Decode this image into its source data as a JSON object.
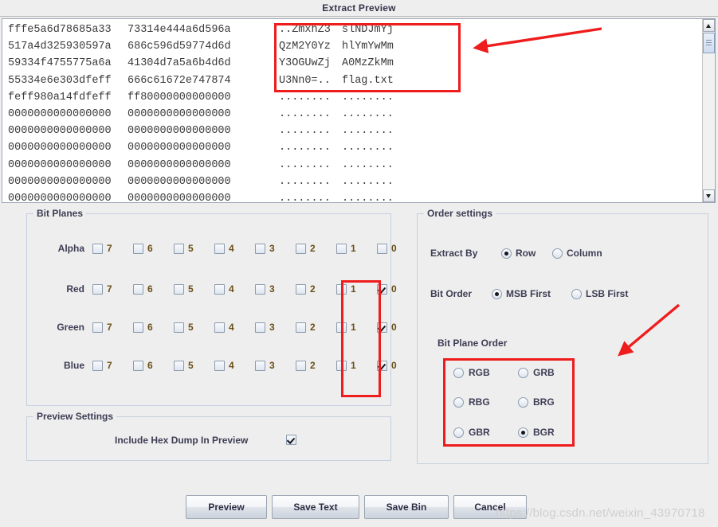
{
  "window": {
    "title": "Extract Preview"
  },
  "hex_dump": {
    "lines": [
      {
        "hex1": "fffe5a6d78685a33",
        "hex2": "73314e444a6d596a",
        "ascii1": "..ZmxhZ3",
        "ascii2": "slNDJmYj"
      },
      {
        "hex1": "517a4d325930597a",
        "hex2": "686c596d59774d6d",
        "ascii1": "QzM2Y0Yz",
        "ascii2": "hlYmYwMm"
      },
      {
        "hex1": "59334f4755775a6a",
        "hex2": "41304d7a5a6b4d6d",
        "ascii1": "Y3OGUwZj",
        "ascii2": "A0MzZkMm"
      },
      {
        "hex1": "55334e6e303dfeff",
        "hex2": "666c61672e747874",
        "ascii1": "U3Nn0=..",
        "ascii2": "flag.txt"
      },
      {
        "hex1": "feff980a14fdfeff",
        "hex2": "ff80000000000000",
        "ascii1": "........",
        "ascii2": "........"
      },
      {
        "hex1": "0000000000000000",
        "hex2": "0000000000000000",
        "ascii1": "........",
        "ascii2": "........"
      },
      {
        "hex1": "0000000000000000",
        "hex2": "0000000000000000",
        "ascii1": "........",
        "ascii2": "........"
      },
      {
        "hex1": "0000000000000000",
        "hex2": "0000000000000000",
        "ascii1": "........",
        "ascii2": "........"
      },
      {
        "hex1": "0000000000000000",
        "hex2": "0000000000000000",
        "ascii1": "........",
        "ascii2": "........"
      },
      {
        "hex1": "0000000000000000",
        "hex2": "0000000000000000",
        "ascii1": "........",
        "ascii2": "........"
      },
      {
        "hex1": "0000000000000000",
        "hex2": "0000000000000000",
        "ascii1": "........",
        "ascii2": "........"
      }
    ]
  },
  "bit_planes": {
    "legend": "Bit Planes",
    "bit_labels": [
      "7",
      "6",
      "5",
      "4",
      "3",
      "2",
      "1",
      "0"
    ],
    "rows": [
      {
        "channel": "Alpha",
        "checked": [
          false,
          false,
          false,
          false,
          false,
          false,
          false,
          false
        ]
      },
      {
        "channel": "Red",
        "checked": [
          false,
          false,
          false,
          false,
          false,
          false,
          false,
          true
        ]
      },
      {
        "channel": "Green",
        "checked": [
          false,
          false,
          false,
          false,
          false,
          false,
          false,
          true
        ]
      },
      {
        "channel": "Blue",
        "checked": [
          false,
          false,
          false,
          false,
          false,
          false,
          false,
          true
        ]
      }
    ]
  },
  "preview_settings": {
    "legend": "Preview Settings",
    "include_hex_dump_label": "Include Hex Dump In Preview",
    "include_hex_dump_checked": true
  },
  "order_settings": {
    "legend": "Order settings",
    "extract_by": {
      "label": "Extract By",
      "options": [
        "Row",
        "Column"
      ],
      "selected": "Row"
    },
    "bit_order": {
      "label": "Bit Order",
      "options": [
        "MSB First",
        "LSB First"
      ],
      "selected": "MSB First"
    },
    "bit_plane_order": {
      "label": "Bit Plane Order",
      "options": [
        "RGB",
        "GRB",
        "RBG",
        "BRG",
        "GBR",
        "BGR"
      ],
      "selected": "BGR"
    }
  },
  "buttons": {
    "preview": "Preview",
    "save_text": "Save Text",
    "save_bin": "Save Bin",
    "cancel": "Cancel"
  },
  "scrollbar": {
    "up_icon": "triangle-up-icon",
    "down_icon": "triangle-down-icon"
  },
  "annotations": {
    "accent_color": "#ee1c1c",
    "arrow_to_ascii": "arrow-pointing-left-to-ascii-box",
    "arrow_to_bit_plane_order": "arrow-pointing-down-left-to-bit-plane-order"
  },
  "watermark": {
    "text": "https://blog.csdn.net/weixin_43970718"
  }
}
